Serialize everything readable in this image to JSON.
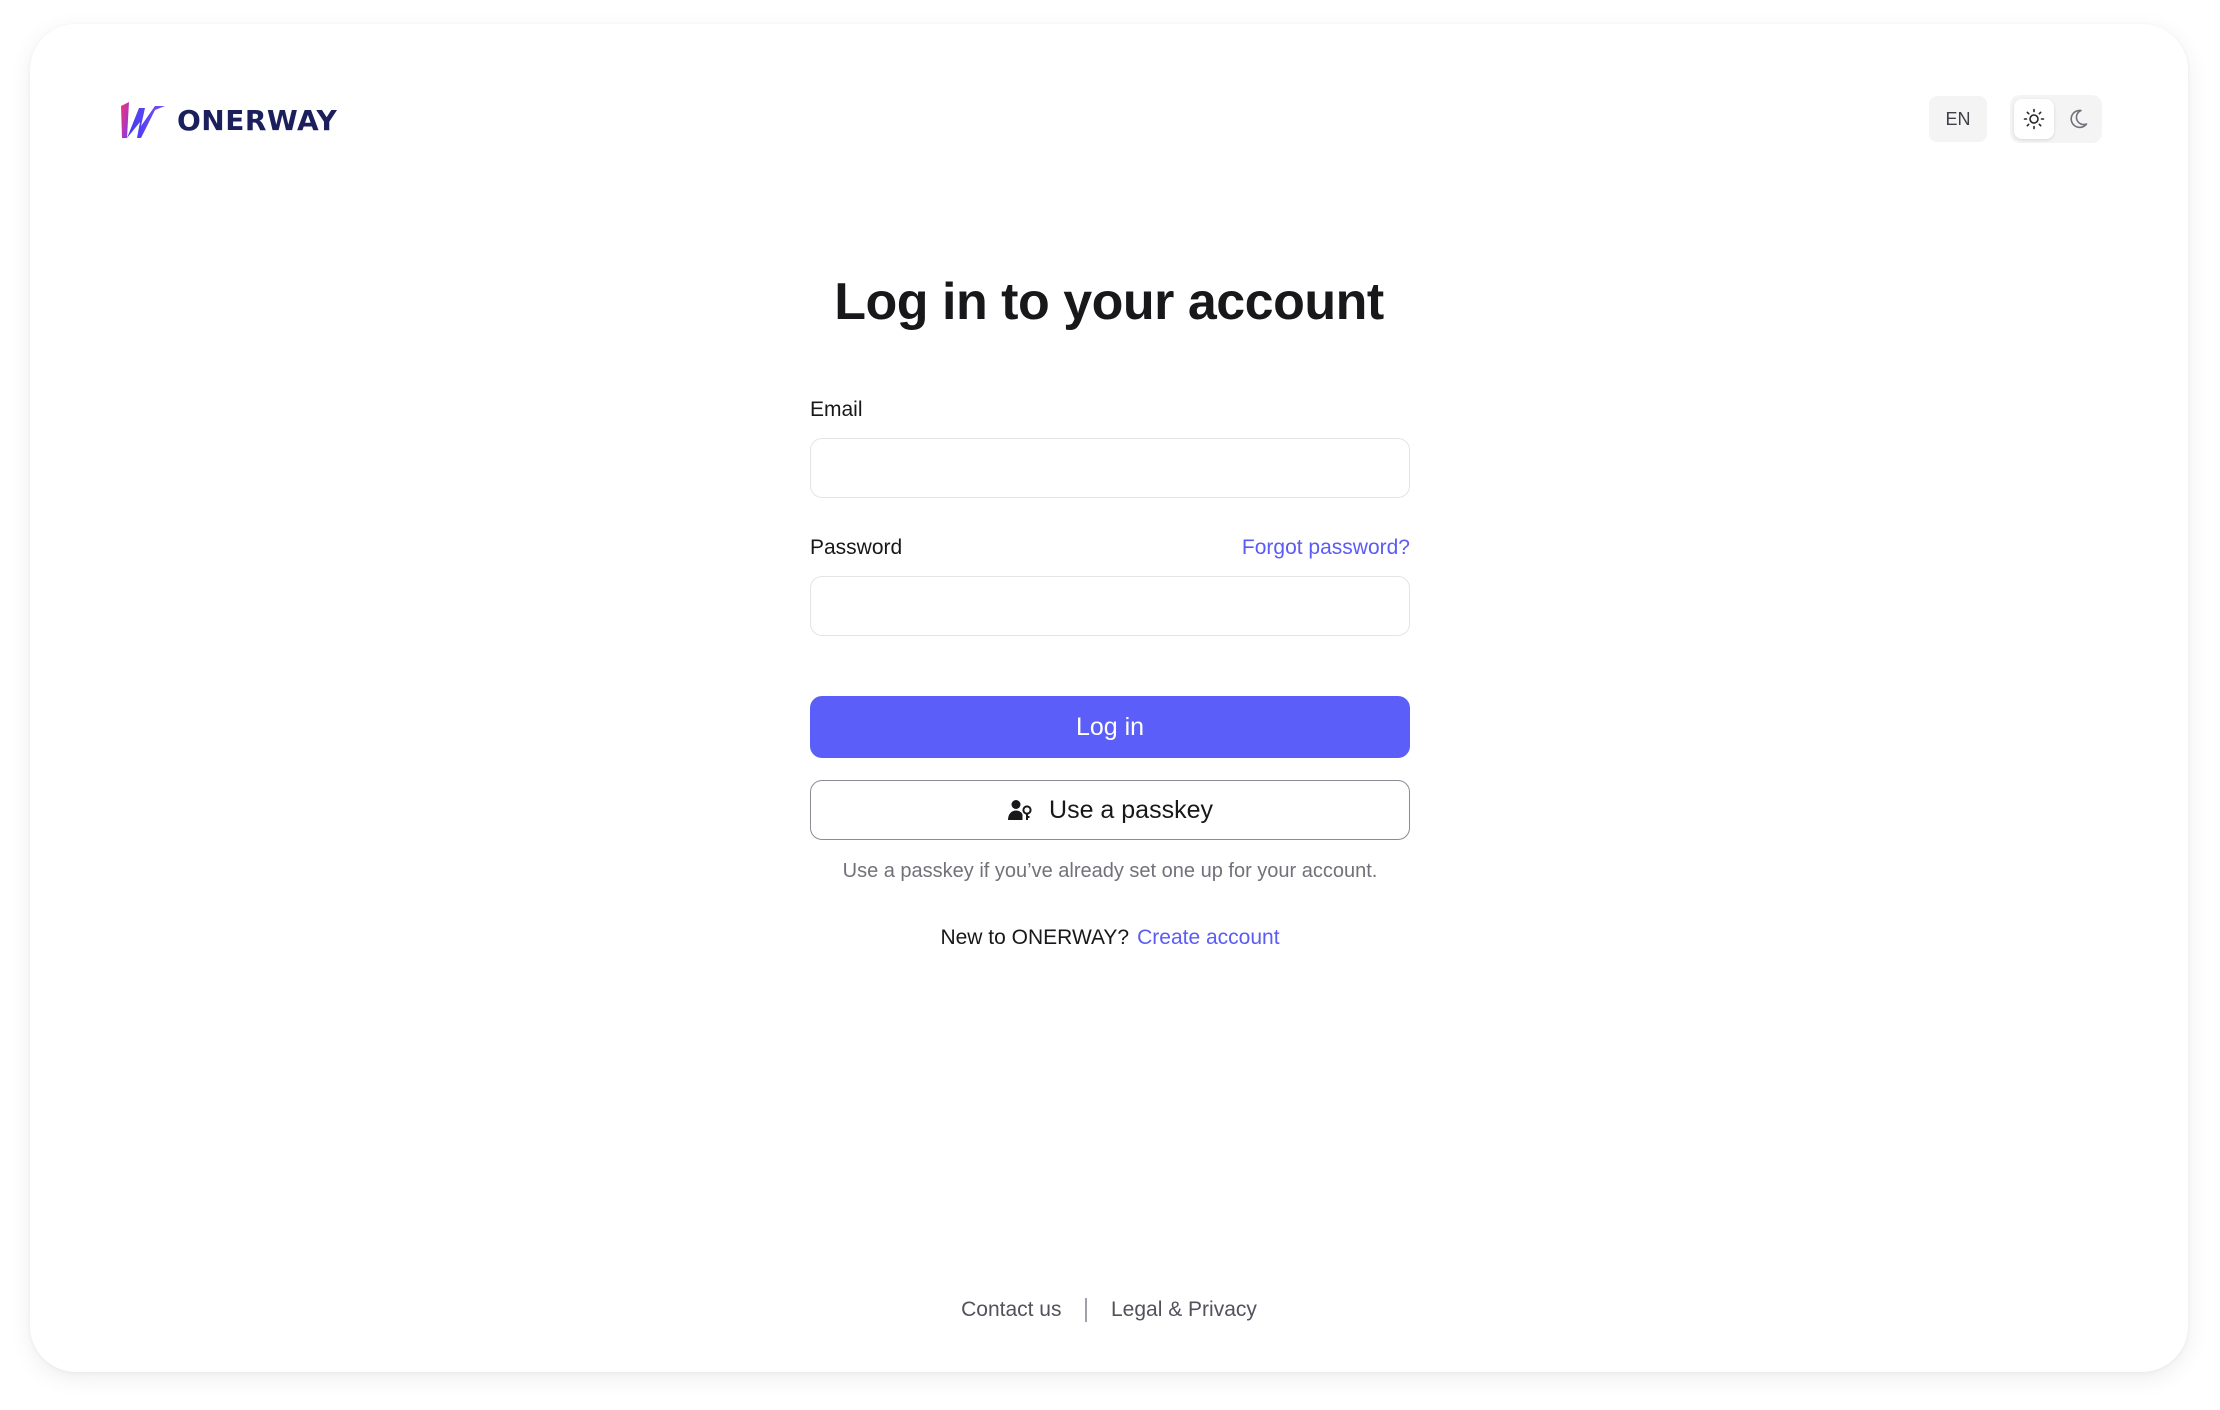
{
  "brand": {
    "name": "ONERWAY",
    "colors": {
      "primary": "#5b5ef8",
      "logo_text": "#1b1f5c",
      "link": "#5b5bf5"
    }
  },
  "header": {
    "language": "EN",
    "theme_toggle": {
      "options": [
        "sun-icon",
        "moon-icon"
      ],
      "selected": "light"
    }
  },
  "form": {
    "title": "Log in to your account",
    "email_label": "Email",
    "email_value": "",
    "password_label": "Password",
    "password_value": "",
    "forgot_password": "Forgot password?",
    "login_button": "Log in",
    "passkey_button": "Use a passkey",
    "passkey_hint": "Use a passkey if you’ve already set one up for your account.",
    "signup_prompt": "New to ONERWAY?",
    "signup_link": "Create account"
  },
  "footer": {
    "contact": "Contact us",
    "legal": "Legal & Privacy"
  }
}
